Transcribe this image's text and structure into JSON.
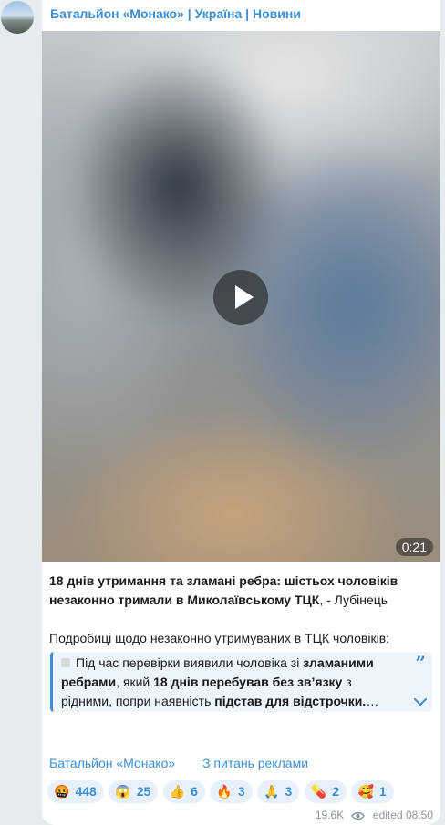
{
  "post": {
    "channel_name": "Батальйон «Монако» | Україна | Новини",
    "video": {
      "duration": "0:21"
    },
    "headline_bold": "18 днів утримання та зламані ребра: шістьох чоловіків незаконно тримали в Миколаївському ТЦК",
    "headline_rest": ", - Лубінець",
    "intro": "Подробиці щодо незаконно утримуваних в ТЦК чоловіків:",
    "quote": {
      "part1": "Під час перевірки виявили чоловіка зі ",
      "bold1": "зламаними ребрами",
      "part2": ", який ",
      "bold2": "18 днів перебував без зв’язку",
      "part3": " з рідними, попри наявність ",
      "bold3": "підстав для відстрочки.",
      "ellipsis": "…"
    },
    "links": [
      "Батальйон «Монако»",
      "З питань реклами"
    ],
    "reactions": [
      {
        "emoji": "🤬",
        "count": "448",
        "icon": "enraged-face-icon"
      },
      {
        "emoji": "😱",
        "count": "25",
        "icon": "screaming-face-icon"
      },
      {
        "emoji": "👍",
        "count": "6",
        "icon": "thumbs-up-icon"
      },
      {
        "emoji": "🔥",
        "count": "3",
        "icon": "fire-icon"
      },
      {
        "emoji": "🙏",
        "count": "3",
        "icon": "praying-hands-icon"
      },
      {
        "emoji": "💊",
        "count": "2",
        "icon": "pill-icon"
      },
      {
        "emoji": "🥰",
        "count": "1",
        "icon": "smiling-hearts-face-icon"
      }
    ],
    "views": "19.6K",
    "edited_label": "edited",
    "time": "08:50"
  },
  "colors": {
    "accent": "#3a8ed6",
    "bubble": "#ffffff",
    "background": "#e6ebee"
  }
}
